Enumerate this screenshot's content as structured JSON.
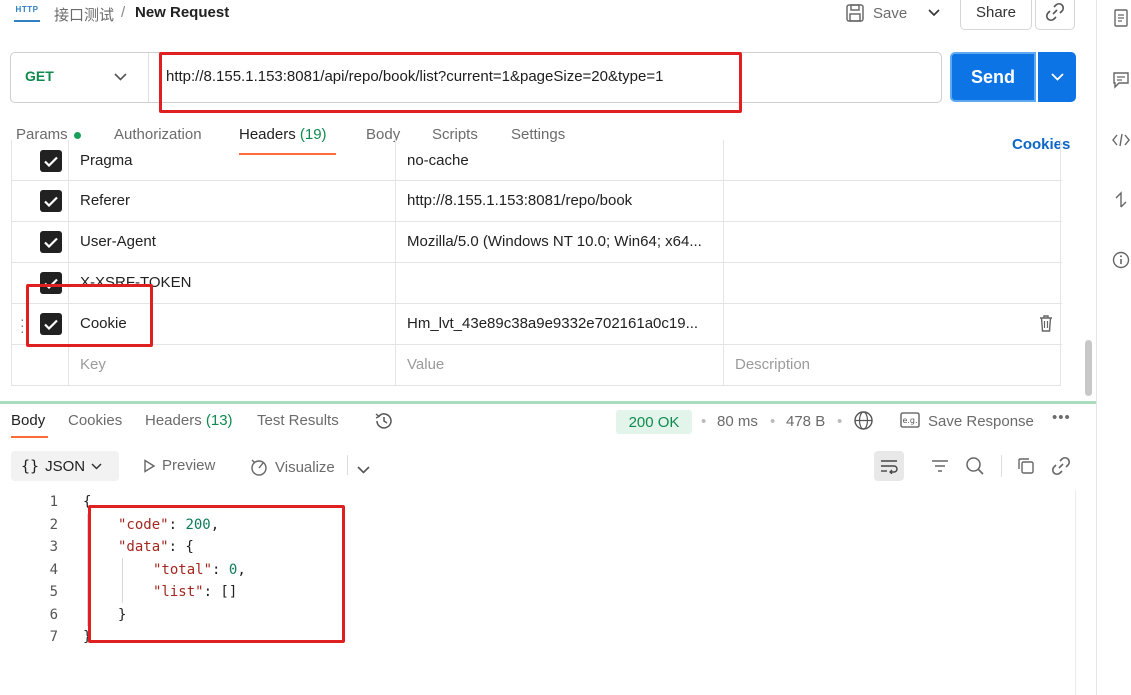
{
  "header": {
    "app_icon_text": "HTTP",
    "breadcrumb_parent": "接口测试",
    "breadcrumb_sep": "/",
    "title": "New Request",
    "save_label": "Save",
    "share_label": "Share"
  },
  "request": {
    "method": "GET",
    "url": "http://8.155.1.153:8081/api/repo/book/list?current=1&pageSize=20&type=1",
    "send_label": "Send"
  },
  "request_tabs": {
    "params": "Params",
    "authorization": "Authorization",
    "headers": "Headers",
    "headers_count": "(19)",
    "body": "Body",
    "scripts": "Scripts",
    "settings": "Settings",
    "cookies_link": "Cookies"
  },
  "headers_table": {
    "rows": [
      {
        "key": "Pragma",
        "value": "no-cache",
        "checked": true
      },
      {
        "key": "Referer",
        "value": "http://8.155.1.153:8081/repo/book",
        "checked": true
      },
      {
        "key": "User-Agent",
        "value": "Mozilla/5.0 (Windows NT 10.0; Win64; x64...",
        "checked": true
      },
      {
        "key": "X-XSRF-TOKEN",
        "value": "",
        "checked": true
      },
      {
        "key": "Cookie",
        "value": "Hm_lvt_43e89c38a9e9332e702161a0c19...",
        "checked": true
      }
    ],
    "placeholder_key": "Key",
    "placeholder_value": "Value",
    "placeholder_description": "Description"
  },
  "response_tabs": {
    "body": "Body",
    "cookies": "Cookies",
    "headers": "Headers",
    "headers_count": "(13)",
    "test_results": "Test Results"
  },
  "response_meta": {
    "status": "200 OK",
    "time": "80 ms",
    "size": "478 B",
    "save_response": "Save Response"
  },
  "response_toolbar": {
    "format": "JSON",
    "preview": "Preview",
    "visualize": "Visualize"
  },
  "code_lines": {
    "n1": "1",
    "n2": "2",
    "n3": "3",
    "n4": "4",
    "n5": "5",
    "n6": "6",
    "n7": "7",
    "l1_open": "{",
    "l2_key": "\"code\"",
    "l2_sep": ": ",
    "l2_val": "200",
    "l2_end": ",",
    "l3_key": "\"data\"",
    "l3_rest": ": {",
    "l4_key": "\"total\"",
    "l4_sep": ": ",
    "l4_val": "0",
    "l4_end": ",",
    "l5_key": "\"list\"",
    "l5_rest": ": []",
    "l6": "}",
    "l7": "}"
  },
  "colors": {
    "accent_orange": "#ff6c37",
    "send_blue": "#0c74e4",
    "method_green": "#0f8a4f",
    "annotation_red": "#e02020"
  }
}
